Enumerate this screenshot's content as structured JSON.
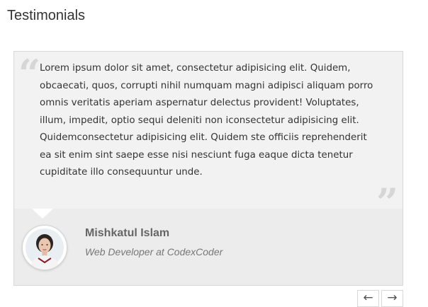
{
  "section": {
    "title": "Testimonials"
  },
  "testimonial": {
    "quote": "Lorem ipsum dolor sit amet, consectetur adipisicing elit. Quidem, obcaecati, quos, corrupti nihil numquam magni adipisci aliquam porro omnis veritatis aperiam aspernatur delectus provident! Voluptates, illum, impedit, optio sequi deleniti non iconsectetur adipisicing elit. Quidemconsectetur adipisicing elit. Quidem ste officiis reprehenderit ea sit enim sint saepe esse nisi nesciunt fuga eaque dicta tenetur cupiditate illo consequuntur unde.",
    "open_quote_glyph": "“",
    "close_quote_glyph": "”",
    "author_name": "Mishkatul Islam",
    "author_role": "Web Developer at CodexCoder",
    "avatar_icon": "person-photo"
  },
  "navigation": {
    "prev_glyph": "←",
    "next_glyph": "→",
    "prev_icon": "arrow-left-icon",
    "next_icon": "arrow-right-icon"
  },
  "colors": {
    "card_background": "#ececec",
    "quote_background": "#f2f2f2",
    "quote_mark": "#d6d6d6",
    "text": "#333333"
  }
}
